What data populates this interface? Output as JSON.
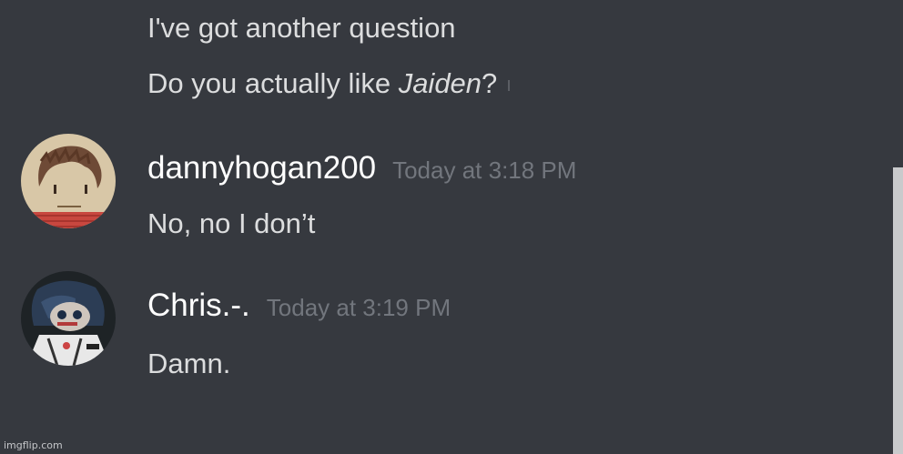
{
  "messages": [
    {
      "text": "I've got another question"
    },
    {
      "pre": "Do you actually like ",
      "italic": "Jaiden",
      "post": "?"
    },
    {
      "username": "dannyhogan200",
      "timestamp": "Today at 3:18 PM",
      "text": "No, no I don’t"
    },
    {
      "username": "Chris.-.",
      "timestamp": "Today at 3:19 PM",
      "text": "Damn."
    }
  ],
  "watermark": "imgflip.com",
  "colors": {
    "background": "#36393f",
    "message_text": "#dcddde",
    "username": "#ffffff",
    "timestamp": "#72767d",
    "scrollbar": "#c9cacc"
  }
}
